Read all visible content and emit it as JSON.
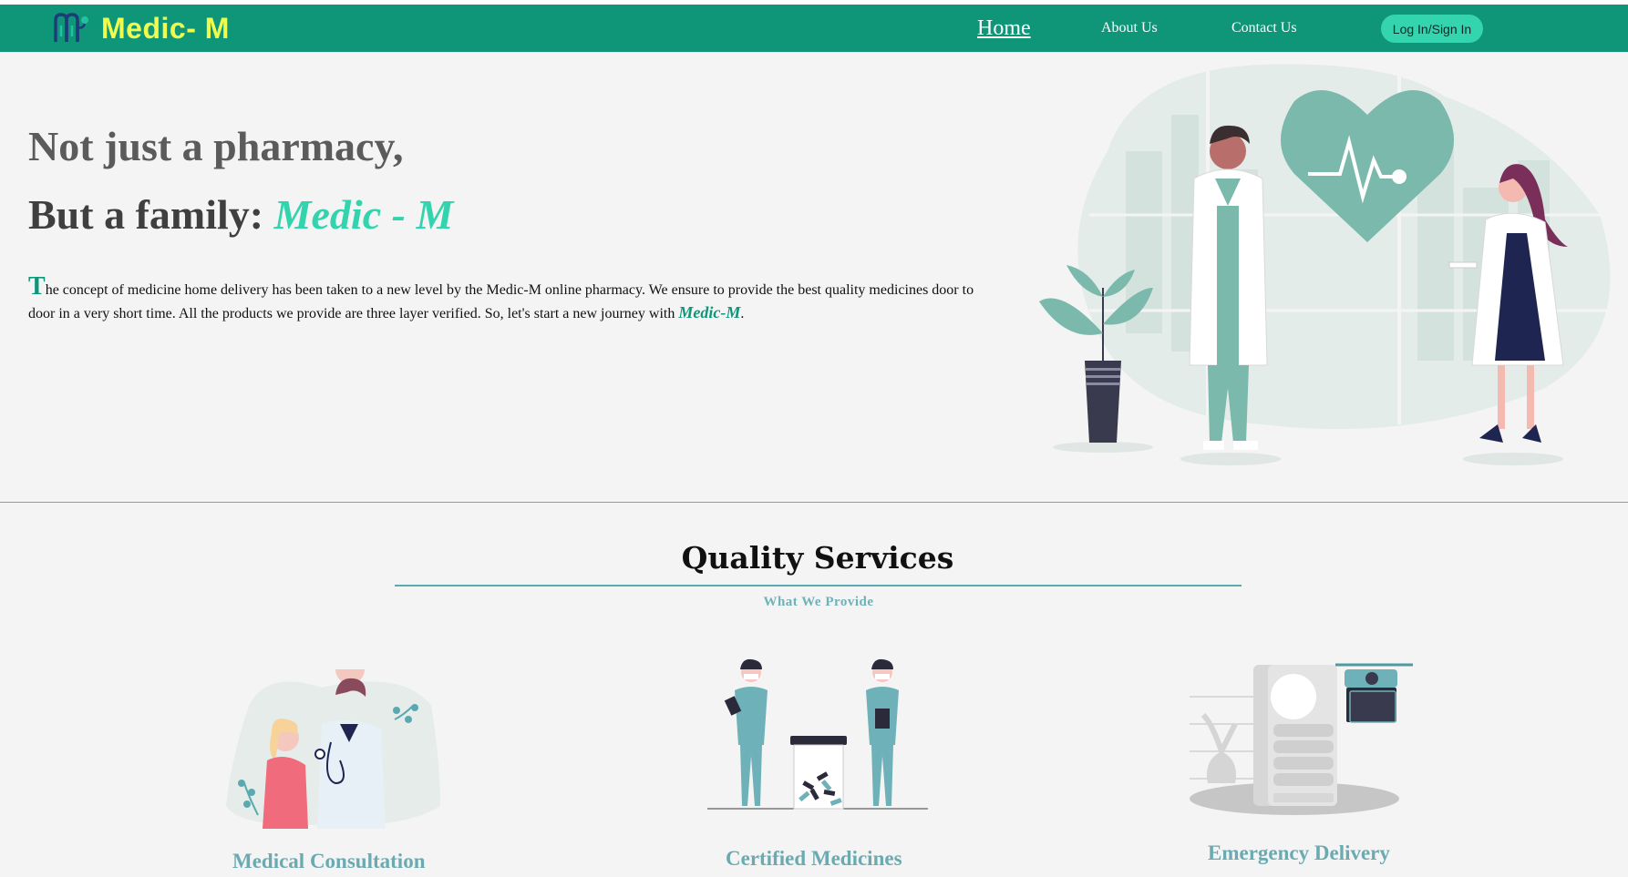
{
  "header": {
    "brand_name": "Medic- M",
    "nav": {
      "home": "Home",
      "about": "About Us",
      "contact": "Contact Us"
    },
    "login_label": "Log In/Sign In"
  },
  "hero": {
    "line1": "Not just a pharmacy,",
    "line2_prefix": "But a family: ",
    "line2_brand": "Medic - M",
    "desc_dropcap": "T",
    "desc_body": "he concept of medicine home delivery has been taken to a new level by the Medic-M online pharmacy. We ensure to provide the best quality medicines door to door in a very short time. All the products we provide are three layer verified. So, let's start a new journey with ",
    "desc_brand": "Medic-M",
    "desc_end": "."
  },
  "services": {
    "heading": "Quality Services",
    "subheading": "What We Provide",
    "items": [
      {
        "label": "Medical Consultation",
        "icon": "doctor-patient-illustration"
      },
      {
        "label": "Certified Medicines",
        "icon": "pharmacists-illustration"
      },
      {
        "label": "Emergency Delivery",
        "icon": "drone-delivery-illustration"
      }
    ]
  },
  "colors": {
    "navbar": "#0f9679",
    "brand_yellow": "#eefc4f",
    "accent": "#32d4ae",
    "teal_label": "#6aaab0",
    "background": "#f4f4f4"
  }
}
